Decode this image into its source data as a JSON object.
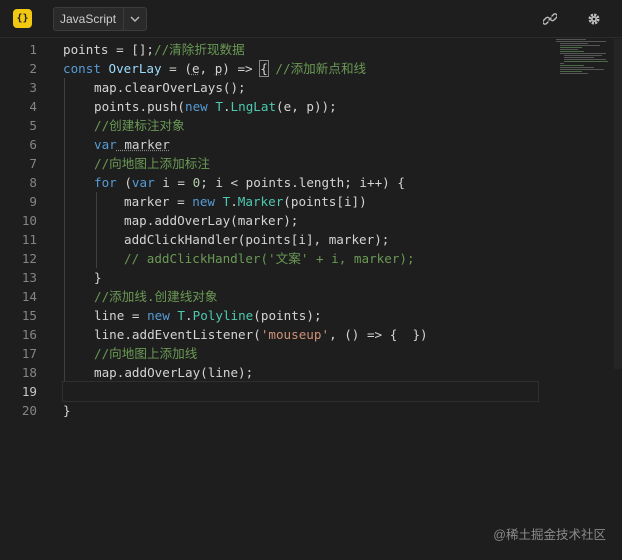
{
  "toolbar": {
    "logo_text": "{}",
    "language": "JavaScript",
    "icons": [
      "link-icon",
      "gear-icon"
    ]
  },
  "editor": {
    "line_numbers": [
      "1",
      "2",
      "3",
      "4",
      "5",
      "6",
      "7",
      "8",
      "9",
      "10",
      "11",
      "12",
      "13",
      "14",
      "15",
      "16",
      "17",
      "18",
      "19",
      "20"
    ],
    "active_line": 19
  },
  "code": {
    "l1": {
      "a": "points = [];",
      "b": "//清除折现数据"
    },
    "l2": {
      "a": "const",
      "b": " ",
      "c": "OverLay",
      "d": " = (",
      "e": "e",
      "f": ", ",
      "g": "p",
      "h": ") => ",
      "i": "{",
      "j": " ",
      "k": "//添加新点和线"
    },
    "l3": "map.clearOverLays();",
    "l4": {
      "a": "points.push(",
      "b": "new",
      "c": " ",
      "d": "T",
      "e": ".",
      "f": "LngLat",
      "g": "(e, p));"
    },
    "l5": "//创建标注对象",
    "l6": {
      "a": "var",
      "b": " marker"
    },
    "l7": "//向地图上添加标注",
    "l8": {
      "a": "for",
      "b": " (",
      "c": "var",
      "d": " i = ",
      "e": "0",
      "f": "; i < points.length; i++) {"
    },
    "l9": {
      "a": "marker = ",
      "b": "new",
      "c": " ",
      "d": "T",
      "e": ".",
      "f": "Marker",
      "g": "(points[i])"
    },
    "l10": "map.addOverLay(marker);",
    "l11": "addClickHandler(points[i], marker);",
    "l12": "// addClickHandler('文案' + i, marker);",
    "l13": "}",
    "l14": "//添加线.创建线对象",
    "l15": {
      "a": "line = ",
      "b": "new",
      "c": " ",
      "d": "T",
      "e": ".",
      "f": "Polyline",
      "g": "(points);"
    },
    "l16": {
      "a": "line.addEventListener(",
      "b": "'mouseup'",
      "c": ", () => {  })"
    },
    "l17": "//向地图上添加线",
    "l18": "map.addOverLay(line);",
    "l19": "",
    "l20": "}"
  },
  "watermark": "@稀土掘金技术社区",
  "colors": {
    "background": "#1e1e1e",
    "keyword": "#569cd6",
    "class": "#4ec9b0",
    "comment": "#6a9955",
    "string": "#ce9178",
    "number": "#b5cea8",
    "logo": "#f2c811"
  }
}
